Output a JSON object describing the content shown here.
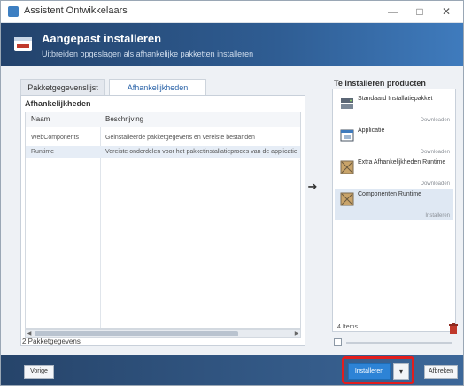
{
  "window": {
    "title": "Assistent Ontwikkelaars",
    "minimize_glyph": "—",
    "maximize_glyph": "□",
    "close_glyph": "✕"
  },
  "header": {
    "title": "Aangepast installeren",
    "subtitle": "Uitbreiden opgeslagen als afhankelijke pakketten installeren"
  },
  "tabs": [
    {
      "label": "Pakketgegevenslijst",
      "active": false
    },
    {
      "label": "Afhankelijkheden",
      "active": true
    }
  ],
  "left_panel": {
    "section_title": "Afhankelijkheden",
    "columns": [
      "Naam",
      "Beschrijving"
    ],
    "rows": [
      {
        "name": "WebComponents",
        "description": "Geinstalleerde pakketgegevens en vereiste bestanden",
        "selected": false
      },
      {
        "name": "Runtime",
        "description": "Vereiste onderdelen voor het pakketinstallatieproces van de applicatie",
        "selected": true
      }
    ],
    "footer_label": "2 Pakketgegevens"
  },
  "arrow_glyph": "➔",
  "right_panel": {
    "title": "Te installeren producten",
    "items": [
      {
        "name": "Standaard Installatiepakket",
        "status": "Downloaden",
        "icon": "server-icon",
        "selected": false
      },
      {
        "name": "Applicatie",
        "status": "Downloaden",
        "icon": "app-icon",
        "selected": false
      },
      {
        "name": "Extra Afhankelijkheden Runtime",
        "status": "Downloaden",
        "icon": "package-icon",
        "selected": false
      },
      {
        "name": "Componenten Runtime",
        "status": "Installeren",
        "icon": "package-icon",
        "selected": true
      }
    ],
    "footer_label": "4 Items"
  },
  "buttons": {
    "back": "Vorige",
    "install": "Installeren",
    "dropdown": "▾",
    "cancel": "Afbreken"
  },
  "colors": {
    "accent": "#2d83d6",
    "header_bg": "#2f5d93",
    "highlight": "#e21d1d"
  }
}
